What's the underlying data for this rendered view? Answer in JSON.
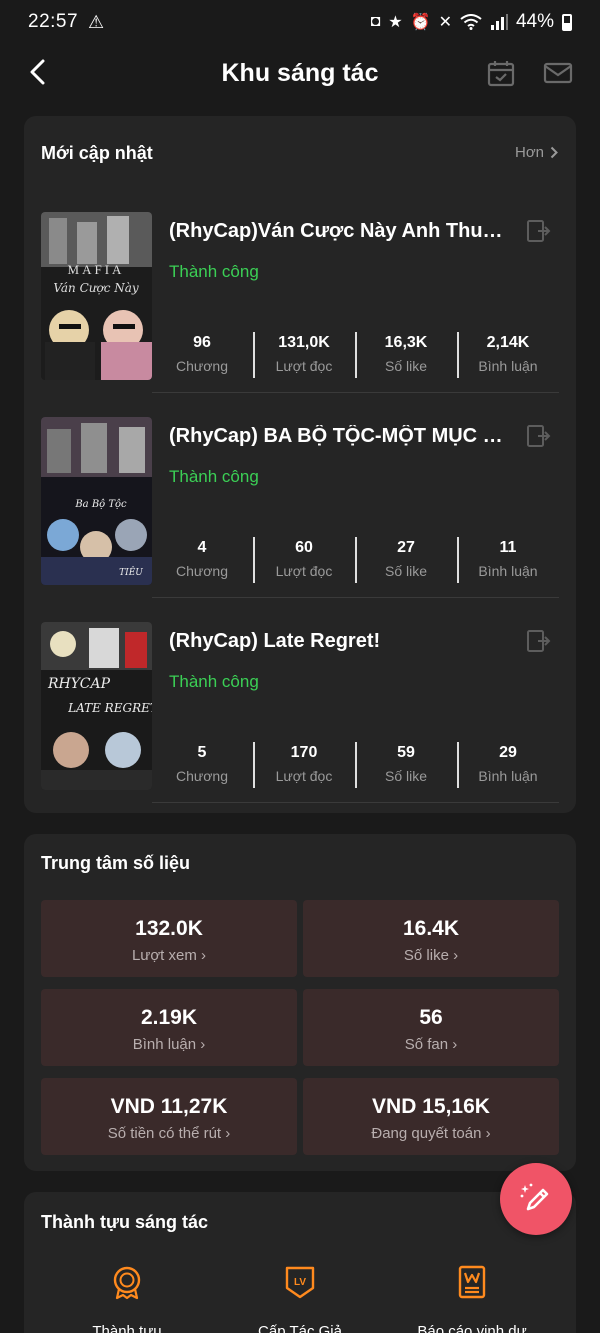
{
  "status_bar": {
    "time": "22:57",
    "battery": "44%"
  },
  "header": {
    "title": "Khu sáng tác"
  },
  "updates": {
    "title": "Mới cập nhật",
    "more_label": "Hơn",
    "stories": [
      {
        "title": "(RhyCap)Ván Cược Này Anh Thua ...",
        "status": "Thành công",
        "stats": [
          {
            "value": "96",
            "label": "Chương"
          },
          {
            "value": "131,0K",
            "label": "Lượt đọc"
          },
          {
            "value": "16,3K",
            "label": "Số like"
          },
          {
            "value": "2,14K",
            "label": "Bình luận"
          }
        ]
      },
      {
        "title": "(RhyCap) BA BỘ TỘC-MỘT MỤC TI...",
        "status": "Thành công",
        "stats": [
          {
            "value": "4",
            "label": "Chương"
          },
          {
            "value": "60",
            "label": "Lượt đọc"
          },
          {
            "value": "27",
            "label": "Số like"
          },
          {
            "value": "11",
            "label": "Bình luận"
          }
        ]
      },
      {
        "title": "(RhyCap) Late Regret!",
        "status": "Thành công",
        "stats": [
          {
            "value": "5",
            "label": "Chương"
          },
          {
            "value": "170",
            "label": "Lượt đọc"
          },
          {
            "value": "59",
            "label": "Số like"
          },
          {
            "value": "29",
            "label": "Bình luận"
          }
        ]
      }
    ]
  },
  "data_center": {
    "title": "Trung tâm số liệu",
    "tiles": [
      {
        "value": "132.0K",
        "label": "Lượt xem"
      },
      {
        "value": "16.4K",
        "label": "Số like"
      },
      {
        "value": "2.19K",
        "label": "Bình luận"
      },
      {
        "value": "56",
        "label": "Số fan"
      },
      {
        "value": "VND 11,27K",
        "label": "Số tiền có thể rút"
      },
      {
        "value": "VND 15,16K",
        "label": "Đang quyết toán"
      }
    ]
  },
  "achievements": {
    "title": "Thành tựu sáng tác",
    "items": [
      {
        "label": "Thành tựu",
        "icon": "medal-icon"
      },
      {
        "label": "Cấp Tác Giả",
        "icon": "level-badge-icon"
      },
      {
        "label": "Báo cáo vinh dự",
        "icon": "honor-report-icon"
      }
    ]
  },
  "colors": {
    "success": "#3bcf55",
    "tile_bg": "#3a2a2a",
    "accent_orange": "#ff8a1e",
    "fab": "#f05467"
  }
}
